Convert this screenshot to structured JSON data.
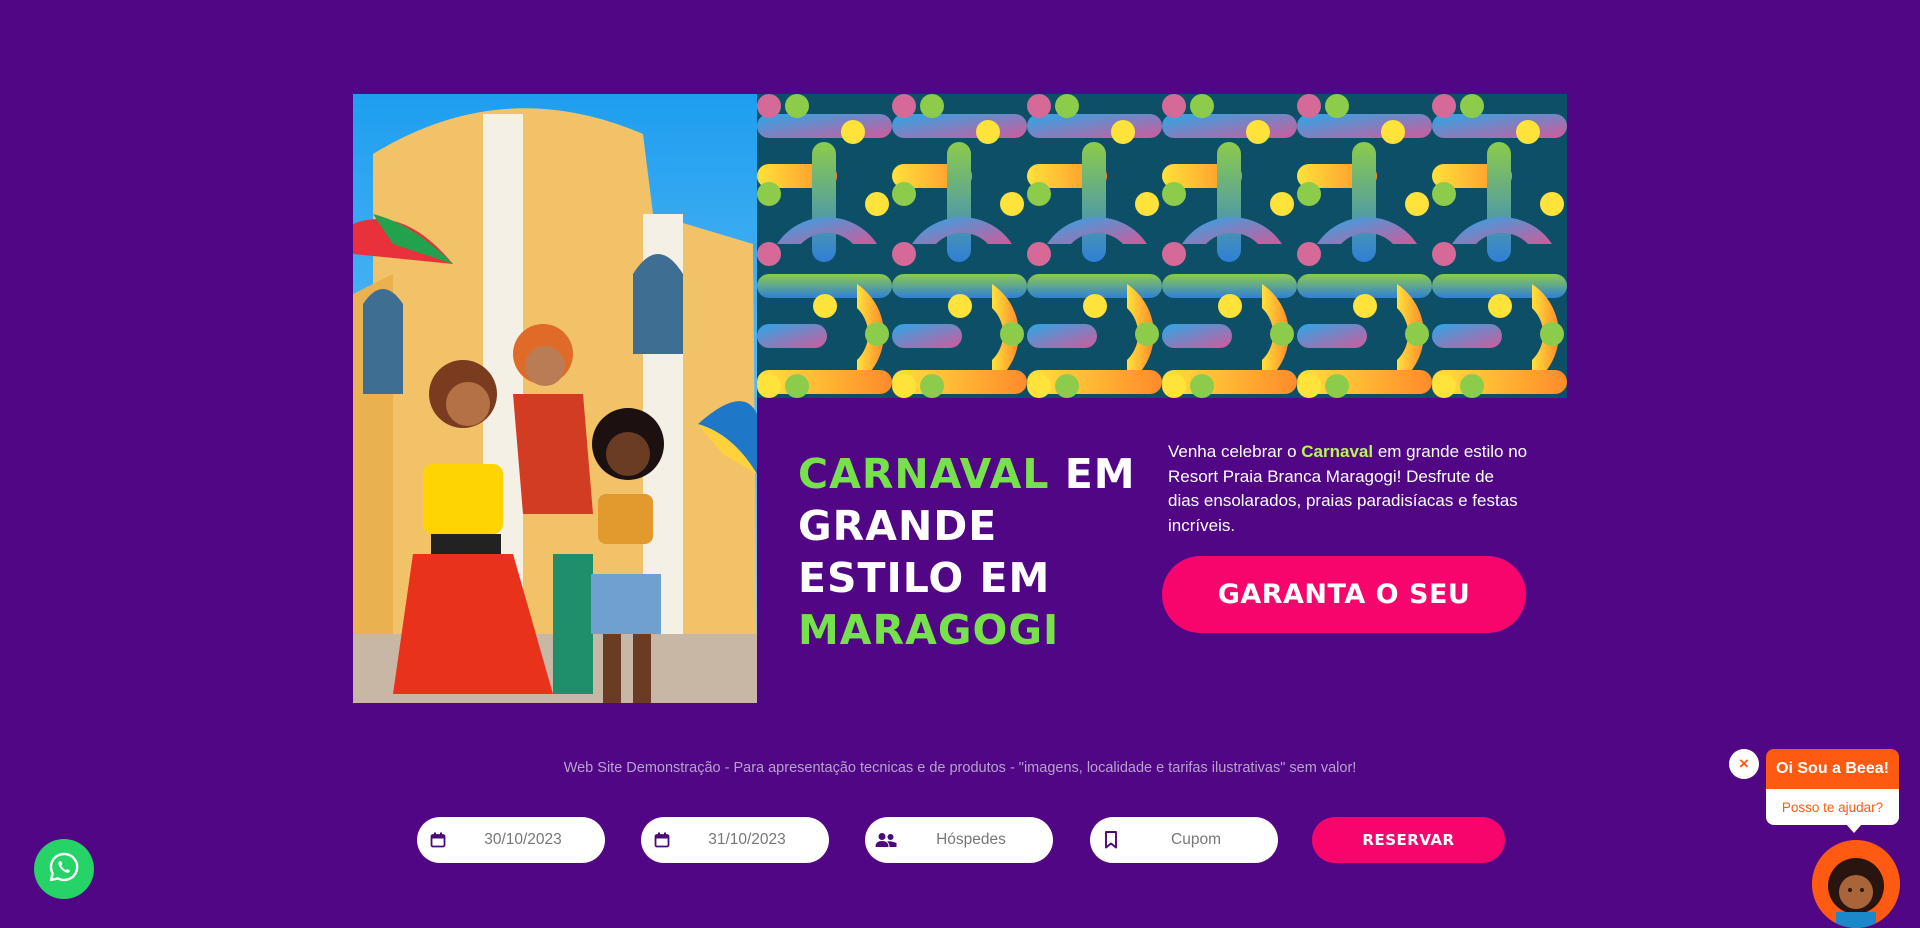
{
  "hero": {
    "headline_part1": "CARNAVAL",
    "headline_part2": " EM GRANDE ESTILO EM ",
    "headline_part3": "MARAGOGI",
    "desc_part1": "Venha celebrar o ",
    "desc_highlight": "Carnaval",
    "desc_part2": " em grande estilo no Resort Praia Branca Maragogi! Desfrute de dias ensolarados, praias paradisíacas e festas incríveis.",
    "cta_label": "GARANTA O SEU"
  },
  "disclaimer": "Web Site Demonstração - Para apresentação tecnicas e de produtos - \"imagens, localidade e tarifas ilustrativas\" sem valor!",
  "booking": {
    "checkin": "30/10/2023",
    "checkout": "31/10/2023",
    "guests_placeholder": "Hóspedes",
    "coupon_placeholder": "Cupom",
    "reserve_label": "RESERVAR"
  },
  "chat": {
    "close": "×",
    "title": "Oi Sou a Beea!",
    "subtitle": "Posso te ajudar?"
  },
  "colors": {
    "background": "#510785",
    "accent_pink": "#f7056d",
    "accent_green": "#77e14b",
    "chat_orange": "#ff5a12",
    "whatsapp_green": "#25d366"
  },
  "icons": {
    "checkin": "calendar-icon",
    "checkout": "calendar-icon",
    "guests": "users-icon",
    "coupon": "bookmark-icon",
    "whatsapp": "whatsapp-icon",
    "close": "close-icon"
  }
}
